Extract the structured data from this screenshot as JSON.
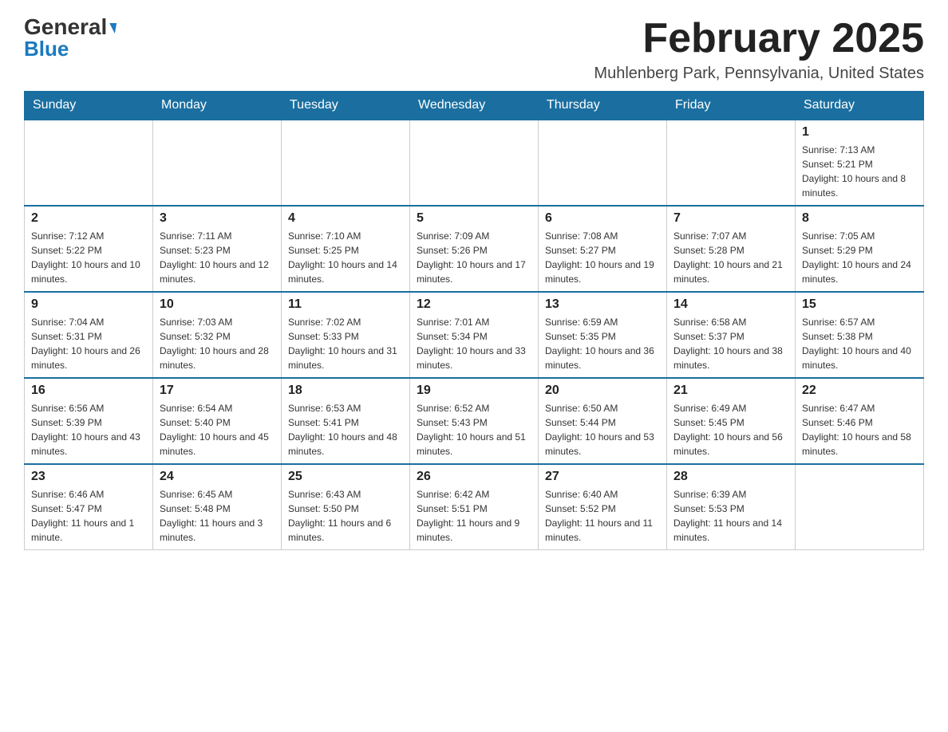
{
  "logo": {
    "part1": "General",
    "part2": "Blue"
  },
  "header": {
    "title": "February 2025",
    "subtitle": "Muhlenberg Park, Pennsylvania, United States"
  },
  "weekdays": [
    "Sunday",
    "Monday",
    "Tuesday",
    "Wednesday",
    "Thursday",
    "Friday",
    "Saturday"
  ],
  "weeks": [
    [
      {
        "day": "",
        "info": ""
      },
      {
        "day": "",
        "info": ""
      },
      {
        "day": "",
        "info": ""
      },
      {
        "day": "",
        "info": ""
      },
      {
        "day": "",
        "info": ""
      },
      {
        "day": "",
        "info": ""
      },
      {
        "day": "1",
        "info": "Sunrise: 7:13 AM\nSunset: 5:21 PM\nDaylight: 10 hours and 8 minutes."
      }
    ],
    [
      {
        "day": "2",
        "info": "Sunrise: 7:12 AM\nSunset: 5:22 PM\nDaylight: 10 hours and 10 minutes."
      },
      {
        "day": "3",
        "info": "Sunrise: 7:11 AM\nSunset: 5:23 PM\nDaylight: 10 hours and 12 minutes."
      },
      {
        "day": "4",
        "info": "Sunrise: 7:10 AM\nSunset: 5:25 PM\nDaylight: 10 hours and 14 minutes."
      },
      {
        "day": "5",
        "info": "Sunrise: 7:09 AM\nSunset: 5:26 PM\nDaylight: 10 hours and 17 minutes."
      },
      {
        "day": "6",
        "info": "Sunrise: 7:08 AM\nSunset: 5:27 PM\nDaylight: 10 hours and 19 minutes."
      },
      {
        "day": "7",
        "info": "Sunrise: 7:07 AM\nSunset: 5:28 PM\nDaylight: 10 hours and 21 minutes."
      },
      {
        "day": "8",
        "info": "Sunrise: 7:05 AM\nSunset: 5:29 PM\nDaylight: 10 hours and 24 minutes."
      }
    ],
    [
      {
        "day": "9",
        "info": "Sunrise: 7:04 AM\nSunset: 5:31 PM\nDaylight: 10 hours and 26 minutes."
      },
      {
        "day": "10",
        "info": "Sunrise: 7:03 AM\nSunset: 5:32 PM\nDaylight: 10 hours and 28 minutes."
      },
      {
        "day": "11",
        "info": "Sunrise: 7:02 AM\nSunset: 5:33 PM\nDaylight: 10 hours and 31 minutes."
      },
      {
        "day": "12",
        "info": "Sunrise: 7:01 AM\nSunset: 5:34 PM\nDaylight: 10 hours and 33 minutes."
      },
      {
        "day": "13",
        "info": "Sunrise: 6:59 AM\nSunset: 5:35 PM\nDaylight: 10 hours and 36 minutes."
      },
      {
        "day": "14",
        "info": "Sunrise: 6:58 AM\nSunset: 5:37 PM\nDaylight: 10 hours and 38 minutes."
      },
      {
        "day": "15",
        "info": "Sunrise: 6:57 AM\nSunset: 5:38 PM\nDaylight: 10 hours and 40 minutes."
      }
    ],
    [
      {
        "day": "16",
        "info": "Sunrise: 6:56 AM\nSunset: 5:39 PM\nDaylight: 10 hours and 43 minutes."
      },
      {
        "day": "17",
        "info": "Sunrise: 6:54 AM\nSunset: 5:40 PM\nDaylight: 10 hours and 45 minutes."
      },
      {
        "day": "18",
        "info": "Sunrise: 6:53 AM\nSunset: 5:41 PM\nDaylight: 10 hours and 48 minutes."
      },
      {
        "day": "19",
        "info": "Sunrise: 6:52 AM\nSunset: 5:43 PM\nDaylight: 10 hours and 51 minutes."
      },
      {
        "day": "20",
        "info": "Sunrise: 6:50 AM\nSunset: 5:44 PM\nDaylight: 10 hours and 53 minutes."
      },
      {
        "day": "21",
        "info": "Sunrise: 6:49 AM\nSunset: 5:45 PM\nDaylight: 10 hours and 56 minutes."
      },
      {
        "day": "22",
        "info": "Sunrise: 6:47 AM\nSunset: 5:46 PM\nDaylight: 10 hours and 58 minutes."
      }
    ],
    [
      {
        "day": "23",
        "info": "Sunrise: 6:46 AM\nSunset: 5:47 PM\nDaylight: 11 hours and 1 minute."
      },
      {
        "day": "24",
        "info": "Sunrise: 6:45 AM\nSunset: 5:48 PM\nDaylight: 11 hours and 3 minutes."
      },
      {
        "day": "25",
        "info": "Sunrise: 6:43 AM\nSunset: 5:50 PM\nDaylight: 11 hours and 6 minutes."
      },
      {
        "day": "26",
        "info": "Sunrise: 6:42 AM\nSunset: 5:51 PM\nDaylight: 11 hours and 9 minutes."
      },
      {
        "day": "27",
        "info": "Sunrise: 6:40 AM\nSunset: 5:52 PM\nDaylight: 11 hours and 11 minutes."
      },
      {
        "day": "28",
        "info": "Sunrise: 6:39 AM\nSunset: 5:53 PM\nDaylight: 11 hours and 14 minutes."
      },
      {
        "day": "",
        "info": ""
      }
    ]
  ]
}
